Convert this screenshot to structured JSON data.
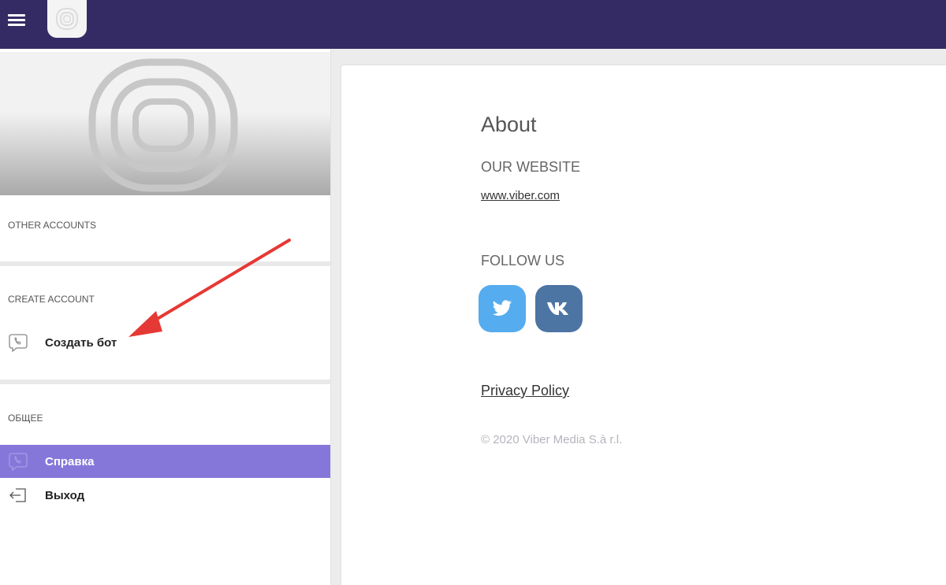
{
  "sidebar": {
    "other_accounts_label": "OTHER ACCOUNTS",
    "create_account_label": "CREATE ACCOUNT",
    "create_bot_label": "Создать бот",
    "general_label": "ОБЩЕЕ",
    "help_label": "Справка",
    "logout_label": "Выход"
  },
  "about": {
    "title": "About",
    "website_heading": "OUR WEBSITE",
    "website_link": "www.viber.com",
    "follow_heading": "FOLLOW US",
    "privacy_link": "Privacy Policy",
    "copyright": "© 2020 Viber Media S.à r.l."
  },
  "icons": {
    "menu": "hamburger-menu-icon",
    "logo": "viber-logo-icon",
    "viber": "viber-phone-icon",
    "logout": "logout-icon",
    "twitter": "twitter-icon",
    "vk": "vk-icon"
  },
  "colors": {
    "topbar": "#352b64",
    "active_item": "#8577d9",
    "twitter": "#55acee",
    "vk": "#4c75a3",
    "annotation_arrow": "#e53935"
  }
}
